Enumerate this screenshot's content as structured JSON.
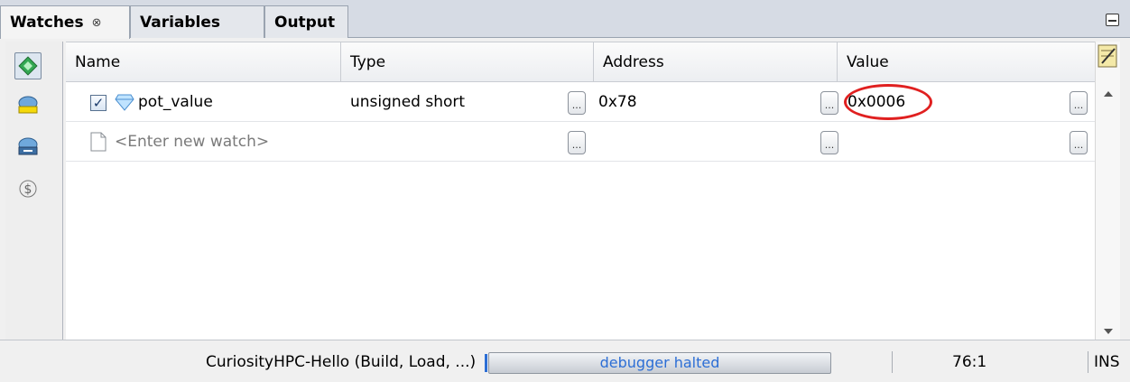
{
  "tabs": [
    {
      "label": "Watches",
      "close": "⊗",
      "active": true
    },
    {
      "label": "Variables",
      "active": false
    },
    {
      "label": "Output",
      "active": false
    }
  ],
  "toolbar_icons": [
    "new-watch-icon",
    "new-runtime-watch-icon",
    "runtime-watch-icon",
    "dollar-icon"
  ],
  "columns": [
    "Name",
    "Type",
    "Address",
    "Value"
  ],
  "rows": [
    {
      "checked": true,
      "name": "pot_value",
      "type": "unsigned short",
      "address": "0x78",
      "value": "0x0006"
    }
  ],
  "new_watch_placeholder": "<Enter new watch>",
  "ellipsis": "...",
  "status": {
    "task": "CuriosityHPC-Hello (Build, Load, ...)",
    "progress_text": "debugger halted",
    "position": "76:1",
    "mode": "INS"
  },
  "colors": {
    "accent": "#2c6ed5",
    "highlight": "#e02020"
  }
}
